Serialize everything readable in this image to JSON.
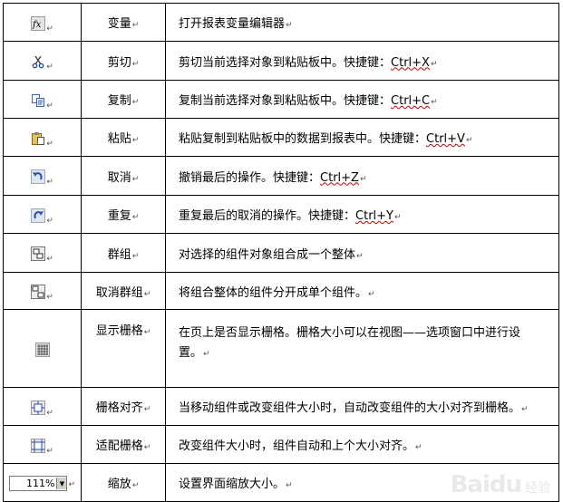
{
  "para_mark": "↵",
  "rows": [
    {
      "name": "变量",
      "icon": "fx-variable-icon",
      "desc": "打开报表变量编辑器"
    },
    {
      "name": "剪切",
      "icon": "cut-icon",
      "desc_pre": "剪切当前选择对象到粘贴板中。快捷键：",
      "shortcut": "Ctrl+X"
    },
    {
      "name": "复制",
      "icon": "copy-icon",
      "desc_pre": "复制当前选择对象到粘贴板中。快捷键：",
      "shortcut": "Ctrl+C"
    },
    {
      "name": "粘贴",
      "icon": "paste-icon",
      "desc_pre": "粘贴复制到粘贴板中的数据到报表中。快捷键：",
      "shortcut": "Ctrl+V"
    },
    {
      "name": "取消",
      "icon": "undo-icon",
      "desc_pre": "撤销最后的操作。快捷键：",
      "shortcut": "Ctrl+Z"
    },
    {
      "name": "重复",
      "icon": "redo-icon",
      "desc_pre": "重复最后的取消的操作。快捷键：",
      "shortcut": "Ctrl+Y"
    },
    {
      "name": "群组",
      "icon": "group-icon",
      "desc": "对选择的组件对象组合成一个整体"
    },
    {
      "name": "取消群组",
      "icon": "ungroup-icon",
      "desc": "将组合整体的组件分开成单个组件。"
    },
    {
      "name": "显示栅格",
      "icon": "grid-icon",
      "desc_line1": "在页上是否显示栅格。栅格大小可以在视图——选项窗口中进行设",
      "desc_line2": "置。"
    },
    {
      "name": "栅格对齐",
      "icon": "snap-to-grid-icon",
      "desc": "当移动组件或改变组件大小时，自动改变组件的大小对齐到栅格。"
    },
    {
      "name": "适配栅格",
      "icon": "fit-to-grid-icon",
      "desc": "改变组件大小时，组件自动和上个大小对齐。"
    },
    {
      "name": "缩放",
      "icon": "zoom-select",
      "zoom_value": "111%",
      "desc": "设置界面缩放大小。"
    }
  ],
  "watermark": {
    "logo": "Baidu",
    "sub": "经验"
  }
}
